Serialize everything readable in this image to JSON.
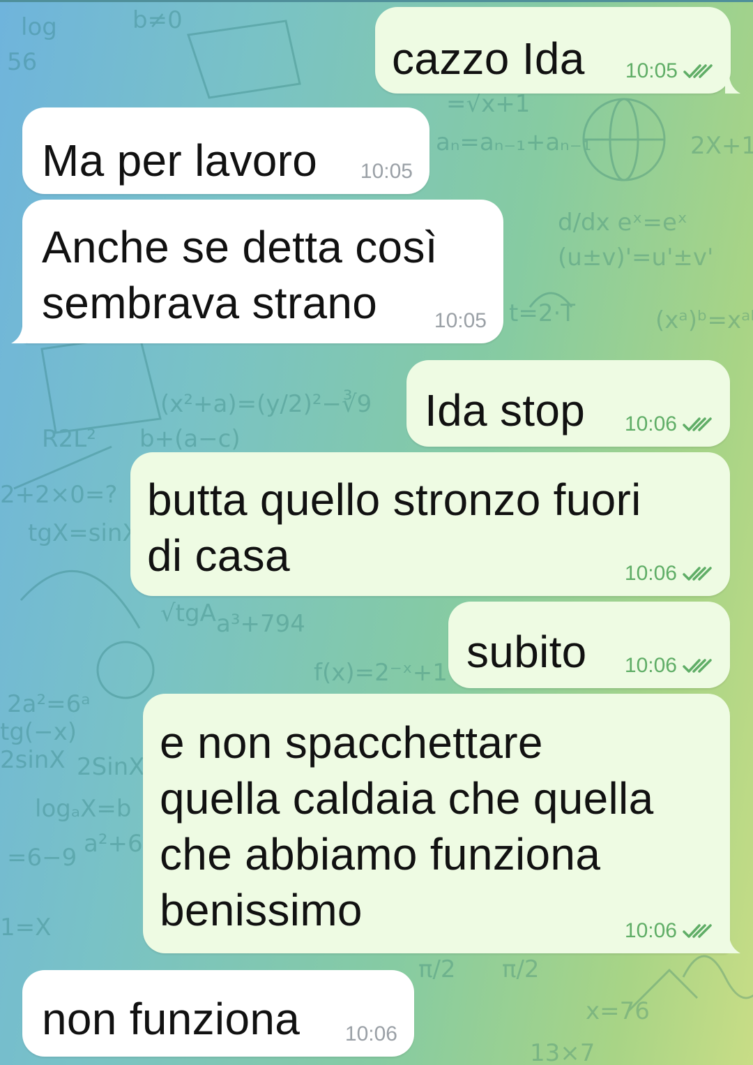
{
  "chat": {
    "colors": {
      "incoming_bubble": "#ffffff",
      "outgoing_bubble": "#eefbe3",
      "incoming_time": "#9aa0a6",
      "outgoing_time_and_ticks": "#5fad66"
    },
    "messages": [
      {
        "direction": "outgoing",
        "text": "cazzo Ida",
        "time": "10:05",
        "status_icon": "double-check-icon"
      },
      {
        "direction": "incoming",
        "text": "Ma per lavoro",
        "time": "10:05"
      },
      {
        "direction": "incoming",
        "text": "Anche se detta così\nsembrava strano",
        "time": "10:05"
      },
      {
        "direction": "outgoing",
        "text": "Ida stop",
        "time": "10:06",
        "status_icon": "double-check-icon"
      },
      {
        "direction": "outgoing",
        "text": "butta quello stronzo fuori\ndi casa",
        "time": "10:06",
        "status_icon": "double-check-icon"
      },
      {
        "direction": "outgoing",
        "text": "subito",
        "time": "10:06",
        "status_icon": "double-check-icon"
      },
      {
        "direction": "outgoing",
        "text": "e non spacchettare\nquella caldaia che quella\nche abbiamo funziona\nbenissimo",
        "time": "10:06",
        "status_icon": "double-check-icon"
      },
      {
        "direction": "incoming",
        "text": "non funziona",
        "time": "10:06"
      }
    ]
  }
}
